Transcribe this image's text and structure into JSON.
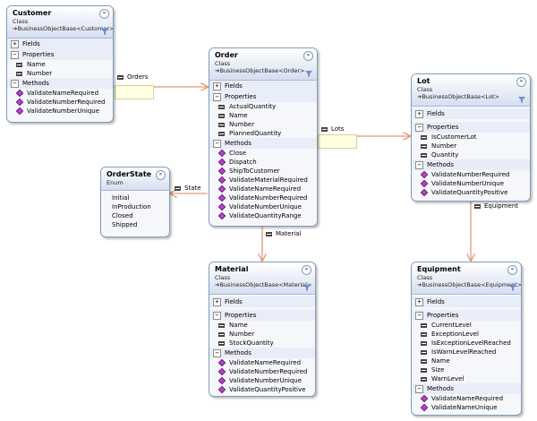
{
  "customer": {
    "name": "Customer",
    "kind": "Class",
    "base": "BusinessObjectBase<Customer>",
    "fields_label": "Fields",
    "properties_label": "Properties",
    "methods_label": "Methods",
    "properties": [
      "Name",
      "Number"
    ],
    "methods": [
      "ValidateNameRequired",
      "ValidateNumberRequired",
      "ValidateNumberUnique"
    ]
  },
  "order": {
    "name": "Order",
    "kind": "Class",
    "base": "BusinessObjectBase<Order>",
    "fields_label": "Fields",
    "properties_label": "Properties",
    "methods_label": "Methods",
    "properties": [
      "ActualQuantity",
      "Name",
      "Number",
      "PlannedQuantity"
    ],
    "methods": [
      "Close",
      "Dispatch",
      "ShipToCustomer",
      "ValidateMaterialRequired",
      "ValidateNameRequired",
      "ValidateNumberRequired",
      "ValidateNumberUnique",
      "ValidateQuantityRange"
    ]
  },
  "lot": {
    "name": "Lot",
    "kind": "Class",
    "base": "BusinessObjectBase<Lot>",
    "fields_label": "Fields",
    "properties_label": "Properties",
    "methods_label": "Methods",
    "properties": [
      "IsCustomerLot",
      "Number",
      "Quantity"
    ],
    "methods": [
      "ValidateNumberRequired",
      "ValidateNumberUnique",
      "ValidateQuantityPositive"
    ]
  },
  "orderstate": {
    "name": "OrderState",
    "kind": "Enum",
    "values": [
      "Initial",
      "InProduction",
      "Closed",
      "Shipped"
    ]
  },
  "material": {
    "name": "Material",
    "kind": "Class",
    "base": "BusinessObjectBase<Material>",
    "fields_label": "Fields",
    "properties_label": "Properties",
    "methods_label": "Methods",
    "properties": [
      "Name",
      "Number",
      "StockQuantity"
    ],
    "methods": [
      "ValidateNameRequired",
      "ValidateNumberRequired",
      "ValidateNumberUnique",
      "ValidateQuantityPositive"
    ]
  },
  "equipment": {
    "name": "Equipment",
    "kind": "Class",
    "base": "BusinessObjectBase<Equipment>",
    "fields_label": "Fields",
    "properties_label": "Properties",
    "methods_label": "Methods",
    "properties": [
      "CurrentLevel",
      "ExceptionLevel",
      "IsExceptionLevelReached",
      "IsWarnLevelReached",
      "Name",
      "Size",
      "WarnLevel"
    ],
    "methods": [
      "ValidateNameRequired",
      "ValidateNameUnique"
    ]
  },
  "associations": {
    "orders": "Orders",
    "lots": "Lots",
    "state": "State",
    "material": "Material",
    "equipment": "Equipment"
  },
  "symbols": {
    "collapse": "»",
    "expand": "+",
    "collapse_section": "−",
    "inherit": "➜"
  },
  "colors": {
    "line": "#e29a73",
    "border": "#7f9db9",
    "method_icon": "#b347c6",
    "note": "#ffffe1"
  }
}
